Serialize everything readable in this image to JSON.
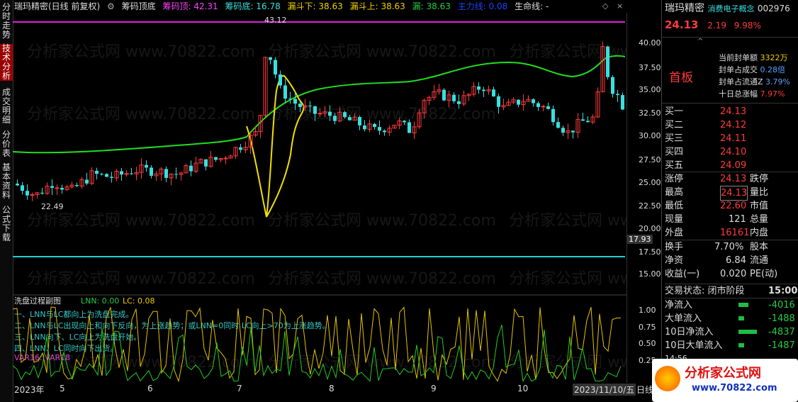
{
  "left_tabs": [
    "分时走势",
    "技术分析",
    "成交明细",
    "分价表",
    "基本资料",
    "公式下载"
  ],
  "header": {
    "stock_title": "瑞玛精密(日线 前复权)",
    "indicator_name": "筹码顶底",
    "chip_top_label": "筹码顶: 42.31",
    "chip_bottom_label": "筹码底: 16.78",
    "funnel_down_label": "漏斗下: 38.63",
    "funnel_up_label": "漏斗上: 38.63",
    "funnel_label": "漏: 38.63",
    "main_force_label": "主力线: 0.08",
    "life_line_label": "生命线: -"
  },
  "price_axis": [
    "40.00",
    "37.50",
    "35.00",
    "32.50",
    "30.00",
    "27.50",
    "25.00",
    "22.50",
    "20.00",
    "17.50",
    "15.00"
  ],
  "price_marker": "17.93",
  "annotations": {
    "high": "43.12",
    "low": "22.49"
  },
  "sub_chart": {
    "title": "洗盘过程副图",
    "lnn_label": "LNN: 0.00",
    "lc_label": "LC: 0.08",
    "notes": [
      "一、LNN与LC都向上为洗盘完成。",
      "二、LNN与LC出现向上和向下反向，为上涨趋势；或LNN=0同时 LC向上>70为上涨趋势。",
      "三、LNN向下、LC向上为洗盘开始。",
      "四、LNN、LC同时向下出货。"
    ],
    "var_label": "VAR16: VAR18",
    "axis": [
      "1.00",
      "0.75",
      "0.50",
      "0.25"
    ]
  },
  "date_axis": [
    "2023年",
    "5",
    "6",
    "7",
    "8",
    "9",
    "10",
    "2023/11/10/五",
    "日线"
  ],
  "watermark": "分析家公式网  www.70822.com",
  "side": {
    "name": "瑞玛精密",
    "concept": "消费电子概念",
    "code": "002976",
    "price": "24.13",
    "change": "2.19",
    "pct": "9.98%",
    "limit_label": "首板",
    "seal_amount_label": "当前封单额",
    "seal_amount": "3322万",
    "seal_vol_ratio_label": "封单占成交",
    "seal_vol_ratio": "0.28倍",
    "seal_float_label": "封单占流通Z",
    "seal_float": "3.79%",
    "ten_day_label": "十日总涨幅",
    "ten_day": "7.97%",
    "bids": [
      {
        "label": "买一",
        "price": "24.13"
      },
      {
        "label": "买二",
        "price": "24.12"
      },
      {
        "label": "买三",
        "price": "24.11"
      },
      {
        "label": "买四",
        "price": "24.10"
      },
      {
        "label": "买五",
        "price": "24.09"
      }
    ],
    "stats": [
      {
        "l": "涨停",
        "v": "24.13",
        "r": "跌停"
      },
      {
        "l": "最高",
        "v": "24.13",
        "r": "量比"
      },
      {
        "l": "最低",
        "v": "22.60",
        "r": "市值"
      },
      {
        "l": "现量",
        "v": "121",
        "r": "总量"
      },
      {
        "l": "外盘",
        "v": "16161",
        "r": "内盘"
      },
      {
        "l": "换手",
        "v": "7.70%",
        "r": "股本"
      },
      {
        "l": "净资",
        "v": "6.84",
        "r": "流通"
      },
      {
        "l": "收益(一)",
        "v": "0.020",
        "r": "PE(动)"
      }
    ],
    "trade_status_label": "交易状态: 闭市阶段",
    "trade_time": "15:00:",
    "flows": [
      {
        "label": "净流入",
        "value": "-4016"
      },
      {
        "label": "大单流入",
        "value": "-1488"
      },
      {
        "label": "10日净流入",
        "value": "-4837"
      },
      {
        "label": "10日大单流入",
        "value": "-1487"
      }
    ],
    "bottom_time": "14:56"
  },
  "logo": {
    "title": "分析家公式网",
    "url": "www.70822.com"
  },
  "colors": {
    "up": "#ff3b3b",
    "down": "#38e0e0",
    "ma": "#22dd22",
    "funnel": "#f0e000",
    "chip_top": "#e020e0",
    "chip_bottom": "#20d0d0"
  }
}
